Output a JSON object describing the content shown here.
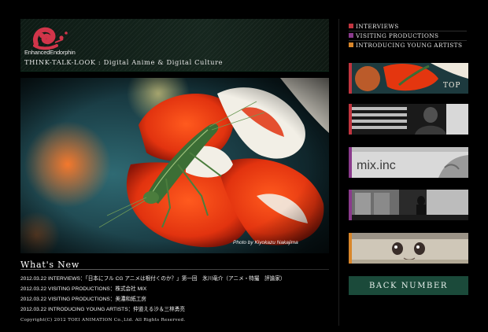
{
  "header": {
    "logo_text": "EnhancedEndorphin",
    "tagline": "THINK-TALK-LOOK : Digital Anime & Digital Culture"
  },
  "hero": {
    "photo_credit": "Photo by Kiyokazu Nakajima"
  },
  "whats_new": {
    "title": "What's New",
    "items": [
      {
        "date": "2012.03.22",
        "text": "INTERVIEWS：「日本にフル CG アニメは根付くのか？」第一回　氷川竜介（アニメ・特撮　評論家）"
      },
      {
        "date": "2012.03.22",
        "text": "VISITING PRODUCTIONS：株式会社 MIX"
      },
      {
        "date": "2012.03.22",
        "text": "VISITING PRODUCTIONS：美濃和紙工房"
      },
      {
        "date": "2012.03.22",
        "text": "INTRODUCING YOUNG ARTISTS：仲道える沙＆三林勇亮"
      }
    ]
  },
  "footer": {
    "copyright": "Copyright(C) 2012 TOEI ANIMATION Co.,Ltd. All Rights Reserved."
  },
  "nav": {
    "items": [
      {
        "label": "INTERVIEWS",
        "color": "#c0343f"
      },
      {
        "label": "VISITING PRODUCTIONS",
        "color": "#8a3a8c"
      },
      {
        "label": "INTRODUCING YOUNG ARTISTS",
        "color": "#d9862a"
      }
    ]
  },
  "thumbs": {
    "top_label": "TOP",
    "mix_label": "mix.inc",
    "bar_colors": [
      "#c0343f",
      "#c0343f",
      "#8a3a8c",
      "#8a3a8c",
      "#d9862a"
    ]
  },
  "back_number": {
    "label": "BACK NUMBER"
  }
}
